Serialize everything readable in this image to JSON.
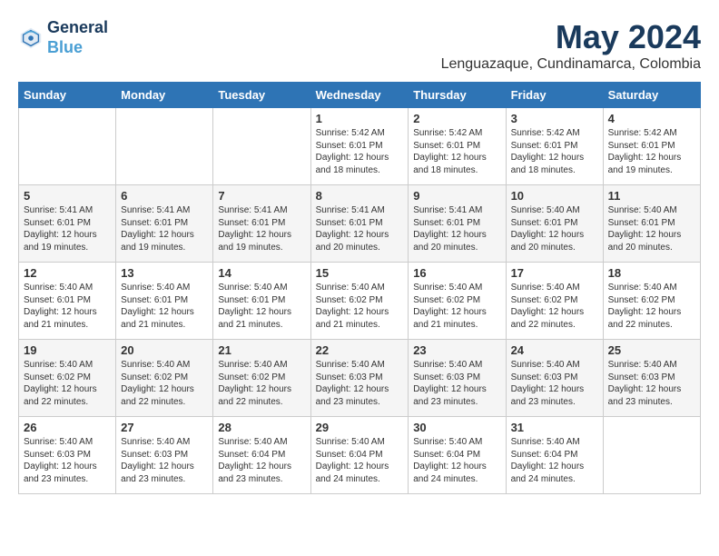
{
  "header": {
    "logo_line1": "General",
    "logo_line2": "Blue",
    "month": "May 2024",
    "location": "Lenguazaque, Cundinamarca, Colombia"
  },
  "weekdays": [
    "Sunday",
    "Monday",
    "Tuesday",
    "Wednesday",
    "Thursday",
    "Friday",
    "Saturday"
  ],
  "weeks": [
    [
      {
        "day": "",
        "info": ""
      },
      {
        "day": "",
        "info": ""
      },
      {
        "day": "",
        "info": ""
      },
      {
        "day": "1",
        "info": "Sunrise: 5:42 AM\nSunset: 6:01 PM\nDaylight: 12 hours\nand 18 minutes."
      },
      {
        "day": "2",
        "info": "Sunrise: 5:42 AM\nSunset: 6:01 PM\nDaylight: 12 hours\nand 18 minutes."
      },
      {
        "day": "3",
        "info": "Sunrise: 5:42 AM\nSunset: 6:01 PM\nDaylight: 12 hours\nand 18 minutes."
      },
      {
        "day": "4",
        "info": "Sunrise: 5:42 AM\nSunset: 6:01 PM\nDaylight: 12 hours\nand 19 minutes."
      }
    ],
    [
      {
        "day": "5",
        "info": "Sunrise: 5:41 AM\nSunset: 6:01 PM\nDaylight: 12 hours\nand 19 minutes."
      },
      {
        "day": "6",
        "info": "Sunrise: 5:41 AM\nSunset: 6:01 PM\nDaylight: 12 hours\nand 19 minutes."
      },
      {
        "day": "7",
        "info": "Sunrise: 5:41 AM\nSunset: 6:01 PM\nDaylight: 12 hours\nand 19 minutes."
      },
      {
        "day": "8",
        "info": "Sunrise: 5:41 AM\nSunset: 6:01 PM\nDaylight: 12 hours\nand 20 minutes."
      },
      {
        "day": "9",
        "info": "Sunrise: 5:41 AM\nSunset: 6:01 PM\nDaylight: 12 hours\nand 20 minutes."
      },
      {
        "day": "10",
        "info": "Sunrise: 5:40 AM\nSunset: 6:01 PM\nDaylight: 12 hours\nand 20 minutes."
      },
      {
        "day": "11",
        "info": "Sunrise: 5:40 AM\nSunset: 6:01 PM\nDaylight: 12 hours\nand 20 minutes."
      }
    ],
    [
      {
        "day": "12",
        "info": "Sunrise: 5:40 AM\nSunset: 6:01 PM\nDaylight: 12 hours\nand 21 minutes."
      },
      {
        "day": "13",
        "info": "Sunrise: 5:40 AM\nSunset: 6:01 PM\nDaylight: 12 hours\nand 21 minutes."
      },
      {
        "day": "14",
        "info": "Sunrise: 5:40 AM\nSunset: 6:01 PM\nDaylight: 12 hours\nand 21 minutes."
      },
      {
        "day": "15",
        "info": "Sunrise: 5:40 AM\nSunset: 6:02 PM\nDaylight: 12 hours\nand 21 minutes."
      },
      {
        "day": "16",
        "info": "Sunrise: 5:40 AM\nSunset: 6:02 PM\nDaylight: 12 hours\nand 21 minutes."
      },
      {
        "day": "17",
        "info": "Sunrise: 5:40 AM\nSunset: 6:02 PM\nDaylight: 12 hours\nand 22 minutes."
      },
      {
        "day": "18",
        "info": "Sunrise: 5:40 AM\nSunset: 6:02 PM\nDaylight: 12 hours\nand 22 minutes."
      }
    ],
    [
      {
        "day": "19",
        "info": "Sunrise: 5:40 AM\nSunset: 6:02 PM\nDaylight: 12 hours\nand 22 minutes."
      },
      {
        "day": "20",
        "info": "Sunrise: 5:40 AM\nSunset: 6:02 PM\nDaylight: 12 hours\nand 22 minutes."
      },
      {
        "day": "21",
        "info": "Sunrise: 5:40 AM\nSunset: 6:02 PM\nDaylight: 12 hours\nand 22 minutes."
      },
      {
        "day": "22",
        "info": "Sunrise: 5:40 AM\nSunset: 6:03 PM\nDaylight: 12 hours\nand 23 minutes."
      },
      {
        "day": "23",
        "info": "Sunrise: 5:40 AM\nSunset: 6:03 PM\nDaylight: 12 hours\nand 23 minutes."
      },
      {
        "day": "24",
        "info": "Sunrise: 5:40 AM\nSunset: 6:03 PM\nDaylight: 12 hours\nand 23 minutes."
      },
      {
        "day": "25",
        "info": "Sunrise: 5:40 AM\nSunset: 6:03 PM\nDaylight: 12 hours\nand 23 minutes."
      }
    ],
    [
      {
        "day": "26",
        "info": "Sunrise: 5:40 AM\nSunset: 6:03 PM\nDaylight: 12 hours\nand 23 minutes."
      },
      {
        "day": "27",
        "info": "Sunrise: 5:40 AM\nSunset: 6:03 PM\nDaylight: 12 hours\nand 23 minutes."
      },
      {
        "day": "28",
        "info": "Sunrise: 5:40 AM\nSunset: 6:04 PM\nDaylight: 12 hours\nand 23 minutes."
      },
      {
        "day": "29",
        "info": "Sunrise: 5:40 AM\nSunset: 6:04 PM\nDaylight: 12 hours\nand 24 minutes."
      },
      {
        "day": "30",
        "info": "Sunrise: 5:40 AM\nSunset: 6:04 PM\nDaylight: 12 hours\nand 24 minutes."
      },
      {
        "day": "31",
        "info": "Sunrise: 5:40 AM\nSunset: 6:04 PM\nDaylight: 12 hours\nand 24 minutes."
      },
      {
        "day": "",
        "info": ""
      }
    ]
  ]
}
